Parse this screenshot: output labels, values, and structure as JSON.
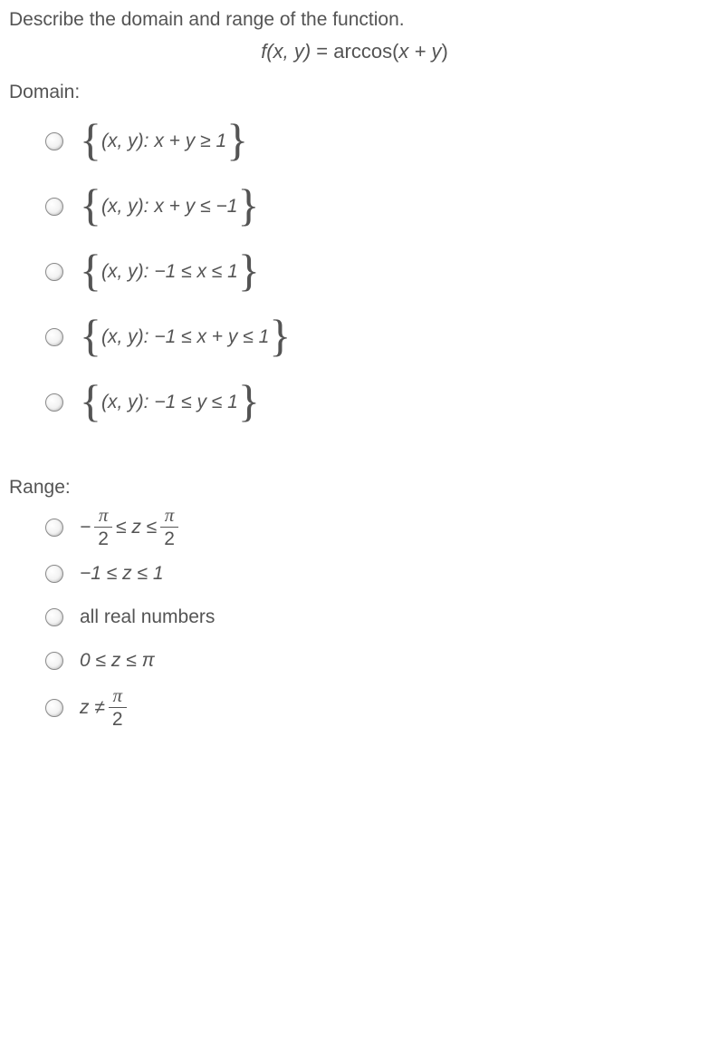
{
  "question": "Describe the domain and range of the function.",
  "formula_lhs": "f(x, y)",
  "formula_eq": " = ",
  "formula_rhs": "arccos(x + y)",
  "domain_label": "Domain:",
  "range_label": "Range:",
  "domain_options": [
    {
      "inner": "(x, y): x + y ≥ 1"
    },
    {
      "inner": "(x, y): x + y ≤ −1"
    },
    {
      "inner": "(x, y): −1 ≤ x ≤ 1"
    },
    {
      "inner": "(x, y): −1 ≤ x + y ≤ 1"
    },
    {
      "inner": "(x, y): −1 ≤ y ≤ 1"
    }
  ],
  "range_options": {
    "o1_pre": "− ",
    "o1_mid": " ≤ z ≤ ",
    "o2": "−1 ≤ z ≤ 1",
    "o3": "all real numbers",
    "o4": "0 ≤ z ≤ π",
    "o5_pre": "z ≠ "
  },
  "pi": "π",
  "two": "2"
}
